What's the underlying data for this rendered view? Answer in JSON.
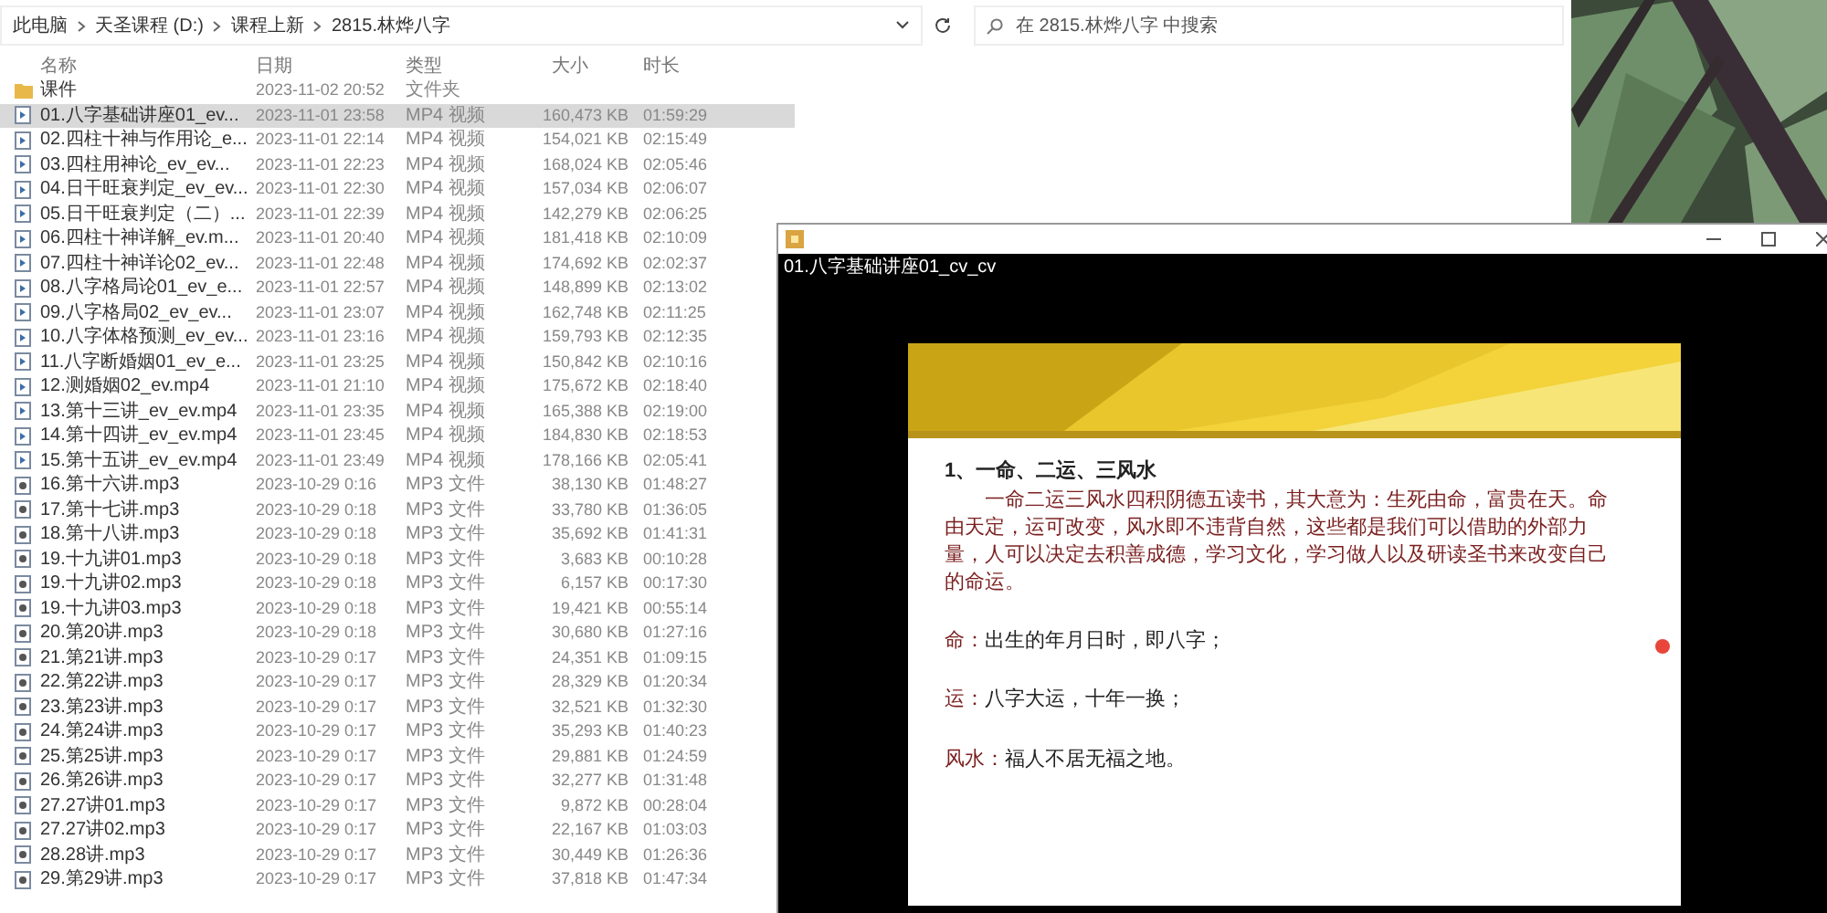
{
  "explorer": {
    "breadcrumb": [
      "此电脑",
      "天圣课程 (D:)",
      "课程上新",
      "2815.林烨八字"
    ],
    "search": {
      "placeholder": "在 2815.林烨八字 中搜索"
    },
    "columns": [
      "名称",
      "日期",
      "类型",
      "大小",
      "时长"
    ],
    "files": [
      {
        "kind": "folder",
        "name": "课件",
        "date": "2023-11-02 20:52",
        "type": "文件夹",
        "selected": false
      },
      {
        "kind": "video",
        "name": "01.八字基础讲座01_ev...",
        "date": "2023-11-01 23:58",
        "type": "MP4 视频",
        "size": "160,473 KB",
        "duration": "01:59:29",
        "selected": true
      },
      {
        "kind": "video",
        "name": "02.四柱十神与作用论_e...",
        "date": "2023-11-01 22:14",
        "type": "MP4 视频",
        "size": "154,021 KB",
        "duration": "02:15:49",
        "selected": false
      },
      {
        "kind": "video",
        "name": "03.四柱用神论_ev_ev...",
        "date": "2023-11-01 22:23",
        "type": "MP4 视频",
        "size": "168,024 KB",
        "duration": "02:05:46",
        "selected": false
      },
      {
        "kind": "video",
        "name": "04.日干旺衰判定_ev_ev...",
        "date": "2023-11-01 22:30",
        "type": "MP4 视频",
        "size": "157,034 KB",
        "duration": "02:06:07",
        "selected": false
      },
      {
        "kind": "video",
        "name": "05.日干旺衰判定（二）...",
        "date": "2023-11-01 22:39",
        "type": "MP4 视频",
        "size": "142,279 KB",
        "duration": "02:06:25",
        "selected": false
      },
      {
        "kind": "video",
        "name": "06.四柱十神详解_ev.m...",
        "date": "2023-11-01 20:40",
        "type": "MP4 视频",
        "size": "181,418 KB",
        "duration": "02:10:09",
        "selected": false
      },
      {
        "kind": "video",
        "name": "07.四柱十神详论02_ev...",
        "date": "2023-11-01 22:48",
        "type": "MP4 视频",
        "size": "174,692 KB",
        "duration": "02:02:37",
        "selected": false
      },
      {
        "kind": "video",
        "name": "08.八字格局论01_ev_e...",
        "date": "2023-11-01 22:57",
        "type": "MP4 视频",
        "size": "148,899 KB",
        "duration": "02:13:02",
        "selected": false
      },
      {
        "kind": "video",
        "name": "09.八字格局02_ev_ev...",
        "date": "2023-11-01 23:07",
        "type": "MP4 视频",
        "size": "162,748 KB",
        "duration": "02:11:25",
        "selected": false
      },
      {
        "kind": "video",
        "name": "10.八字体格预测_ev_ev...",
        "date": "2023-11-01 23:16",
        "type": "MP4 视频",
        "size": "159,793 KB",
        "duration": "02:12:35",
        "selected": false
      },
      {
        "kind": "video",
        "name": "11.八字断婚姻01_ev_e...",
        "date": "2023-11-01 23:25",
        "type": "MP4 视频",
        "size": "150,842 KB",
        "duration": "02:10:16",
        "selected": false
      },
      {
        "kind": "video",
        "name": "12.测婚姻02_ev.mp4",
        "date": "2023-11-01 21:10",
        "type": "MP4 视频",
        "size": "175,672 KB",
        "duration": "02:18:40",
        "selected": false
      },
      {
        "kind": "video",
        "name": "13.第十三讲_ev_ev.mp4",
        "date": "2023-11-01 23:35",
        "type": "MP4 视频",
        "size": "165,388 KB",
        "duration": "02:19:00",
        "selected": false
      },
      {
        "kind": "video",
        "name": "14.第十四讲_ev_ev.mp4",
        "date": "2023-11-01 23:45",
        "type": "MP4 视频",
        "size": "184,830 KB",
        "duration": "02:18:53",
        "selected": false
      },
      {
        "kind": "video",
        "name": "15.第十五讲_ev_ev.mp4",
        "date": "2023-11-01 23:49",
        "type": "MP4 视频",
        "size": "178,166 KB",
        "duration": "02:05:41",
        "selected": false
      },
      {
        "kind": "audio",
        "name": "16.第十六讲.mp3",
        "date": "2023-10-29 0:16",
        "type": "MP3 文件",
        "size": "38,130 KB",
        "duration": "01:48:27",
        "selected": false
      },
      {
        "kind": "audio",
        "name": "17.第十七讲.mp3",
        "date": "2023-10-29 0:18",
        "type": "MP3 文件",
        "size": "33,780 KB",
        "duration": "01:36:05",
        "selected": false
      },
      {
        "kind": "audio",
        "name": "18.第十八讲.mp3",
        "date": "2023-10-29 0:18",
        "type": "MP3 文件",
        "size": "35,692 KB",
        "duration": "01:41:31",
        "selected": false
      },
      {
        "kind": "audio",
        "name": "19.十九讲01.mp3",
        "date": "2023-10-29 0:18",
        "type": "MP3 文件",
        "size": "3,683 KB",
        "duration": "00:10:28",
        "selected": false
      },
      {
        "kind": "audio",
        "name": "19.十九讲02.mp3",
        "date": "2023-10-29 0:18",
        "type": "MP3 文件",
        "size": "6,157 KB",
        "duration": "00:17:30",
        "selected": false
      },
      {
        "kind": "audio",
        "name": "19.十九讲03.mp3",
        "date": "2023-10-29 0:18",
        "type": "MP3 文件",
        "size": "19,421 KB",
        "duration": "00:55:14",
        "selected": false
      },
      {
        "kind": "audio",
        "name": "20.第20讲.mp3",
        "date": "2023-10-29 0:18",
        "type": "MP3 文件",
        "size": "30,680 KB",
        "duration": "01:27:16",
        "selected": false
      },
      {
        "kind": "audio",
        "name": "21.第21讲.mp3",
        "date": "2023-10-29 0:17",
        "type": "MP3 文件",
        "size": "24,351 KB",
        "duration": "01:09:15",
        "selected": false
      },
      {
        "kind": "audio",
        "name": "22.第22讲.mp3",
        "date": "2023-10-29 0:17",
        "type": "MP3 文件",
        "size": "28,329 KB",
        "duration": "01:20:34",
        "selected": false
      },
      {
        "kind": "audio",
        "name": "23.第23讲.mp3",
        "date": "2023-10-29 0:17",
        "type": "MP3 文件",
        "size": "32,521 KB",
        "duration": "01:32:30",
        "selected": false
      },
      {
        "kind": "audio",
        "name": "24.第24讲.mp3",
        "date": "2023-10-29 0:17",
        "type": "MP3 文件",
        "size": "35,293 KB",
        "duration": "01:40:23",
        "selected": false
      },
      {
        "kind": "audio",
        "name": "25.第25讲.mp3",
        "date": "2023-10-29 0:17",
        "type": "MP3 文件",
        "size": "29,881 KB",
        "duration": "01:24:59",
        "selected": false
      },
      {
        "kind": "audio",
        "name": "26.第26讲.mp3",
        "date": "2023-10-29 0:17",
        "type": "MP3 文件",
        "size": "32,277 KB",
        "duration": "01:31:48",
        "selected": false
      },
      {
        "kind": "audio",
        "name": "27.27讲01.mp3",
        "date": "2023-10-29 0:17",
        "type": "MP3 文件",
        "size": "9,872 KB",
        "duration": "00:28:04",
        "selected": false
      },
      {
        "kind": "audio",
        "name": "27.27讲02.mp3",
        "date": "2023-10-29 0:17",
        "type": "MP3 文件",
        "size": "22,167 KB",
        "duration": "01:03:03",
        "selected": false
      },
      {
        "kind": "audio",
        "name": "28.28讲.mp3",
        "date": "2023-10-29 0:17",
        "type": "MP3 文件",
        "size": "30,449 KB",
        "duration": "01:26:36",
        "selected": false
      },
      {
        "kind": "audio",
        "name": "29.第29讲.mp3",
        "date": "2023-10-29 0:17",
        "type": "MP3 文件",
        "size": "37,818 KB",
        "duration": "01:47:34",
        "selected": false
      }
    ]
  },
  "player": {
    "title": "01.八字基础讲座01_cv_cv",
    "slide": {
      "heading": "1、一命、二运、三风水",
      "paragraph": "一命二运三风水四积阴德五读书，其大意为：生死由命，富贵在天。命由天定，运可改变，风水即不违背自然，这些都是我们可以借助的外部力量，人可以决定去积善成德，学习文化，学习做人以及研读圣书来改变自己的命运。",
      "items": [
        {
          "label": "命：",
          "text": "出生的年月日时，即八字；"
        },
        {
          "label": "运：",
          "text": "八字大运，十年一换；"
        },
        {
          "label": "风水：",
          "text": "福人不居无福之地。"
        }
      ]
    }
  }
}
